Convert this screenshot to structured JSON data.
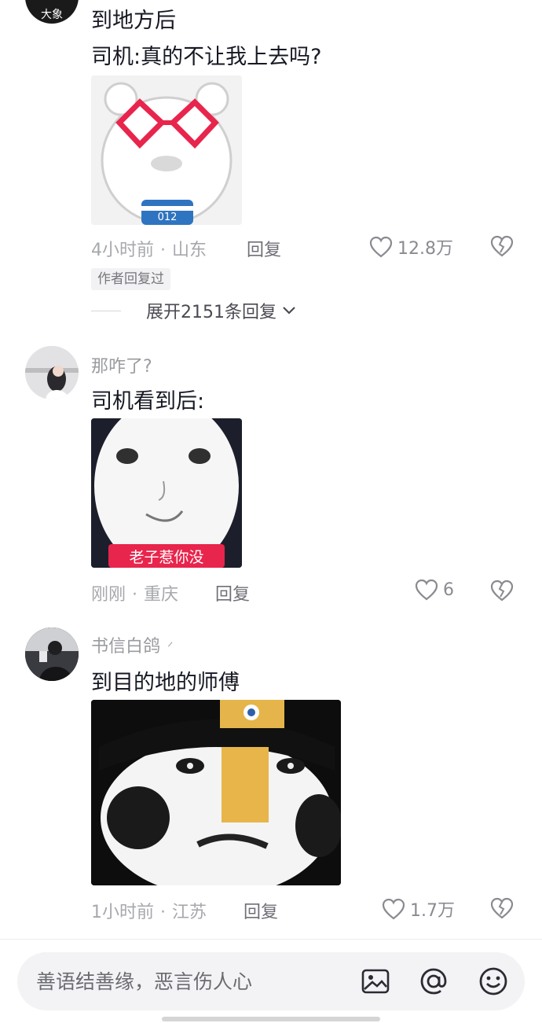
{
  "comments": [
    {
      "avatar_text": "大象",
      "username": "",
      "lines": [
        "到地方后",
        "司机:真的不让我上去吗?"
      ],
      "sticker_text": "012",
      "time": "4小时前",
      "location": "山东",
      "reply_label": "回复",
      "likes": "12.8万",
      "author_tag": "作者回复过",
      "expand_label": "展开2151条回复"
    },
    {
      "username": "那咋了?",
      "lines": [
        "司机看到后:"
      ],
      "sticker_text": "老子惹你没",
      "time": "刚刚",
      "location": "重庆",
      "reply_label": "回复",
      "likes": "6"
    },
    {
      "username": "书信白鸽",
      "lines": [
        "到目的地的师傅"
      ],
      "time": "1小时前",
      "location": "江苏",
      "reply_label": "回复",
      "likes": "1.7万"
    }
  ],
  "input": {
    "placeholder": "善语结善缘，恶言伤人心"
  },
  "icons": {
    "like": "heart-outline-icon",
    "dislike": "broken-heart-icon",
    "expand": "chevron-down-icon",
    "image": "image-icon",
    "mention": "at-icon",
    "emoji": "smiley-icon"
  },
  "colors": {
    "accent_red": "#e8254c",
    "muted": "#a7a8ad",
    "text": "#161823"
  }
}
